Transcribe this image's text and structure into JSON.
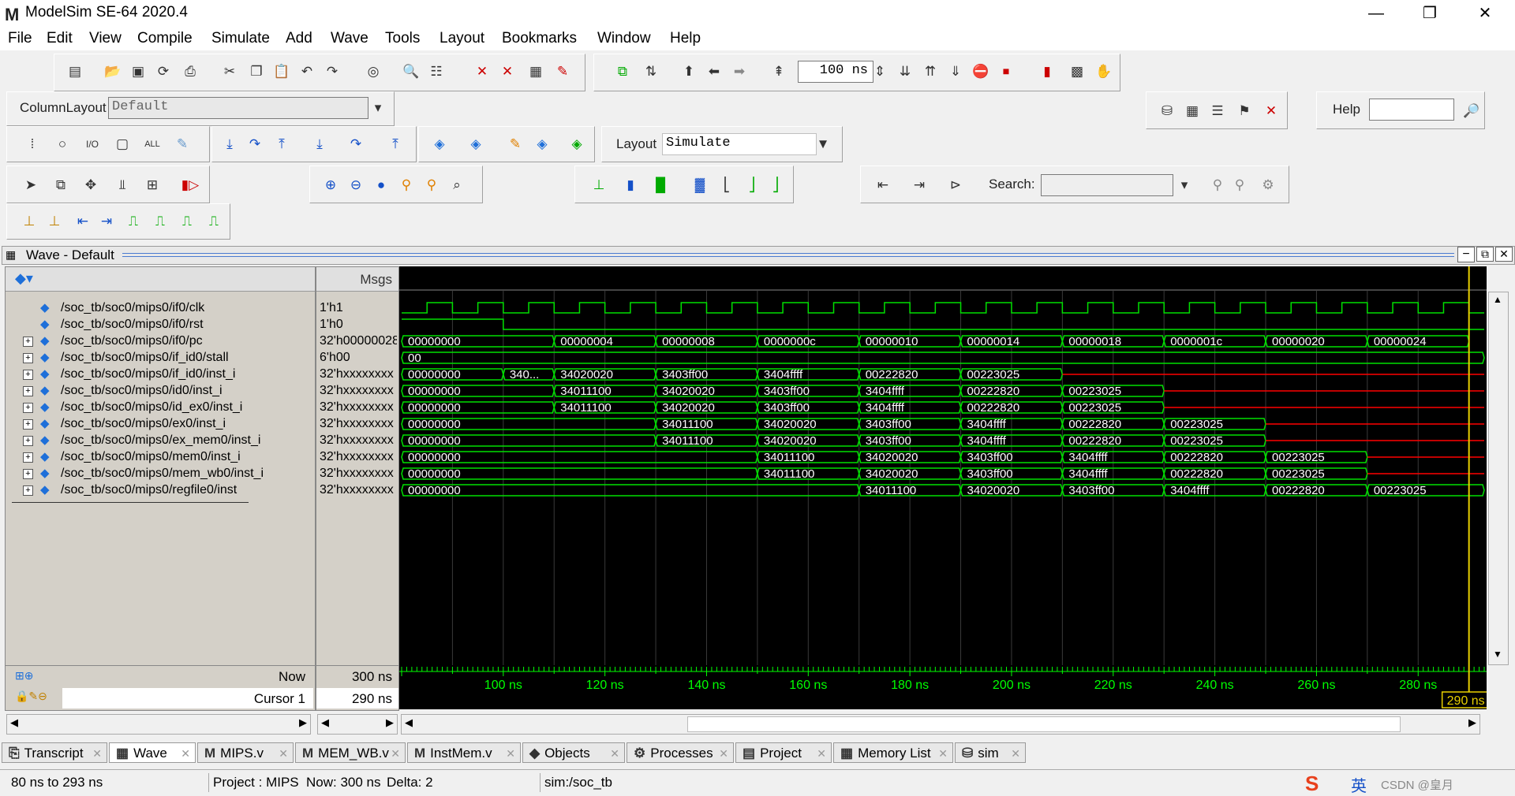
{
  "app": {
    "title": "ModelSim SE-64 2020.4",
    "logo_letter": "M",
    "window_controls": [
      "—",
      "❐",
      "✕"
    ]
  },
  "menu": [
    "File",
    "Edit",
    "View",
    "Compile",
    "Simulate",
    "Add",
    "Wave",
    "Tools",
    "Layout",
    "Bookmarks",
    "Window",
    "Help"
  ],
  "toolbar": {
    "run_length": "100 ns",
    "column_layout_label": "ColumnLayout",
    "column_layout_value": "Default",
    "layout_label": "Layout",
    "layout_value": "Simulate",
    "help_label": "Help",
    "search_label": "Search:"
  },
  "wave": {
    "window_title": "Wave - Default",
    "msgs_header": "Msgs",
    "signals": [
      {
        "name": "/soc_tb/soc0/mips0/if0/clk",
        "value": "1'h1",
        "expandable": false
      },
      {
        "name": "/soc_tb/soc0/mips0/if0/rst",
        "value": "1'h0",
        "expandable": false
      },
      {
        "name": "/soc_tb/soc0/mips0/if0/pc",
        "value": "32'h00000028",
        "expandable": true
      },
      {
        "name": "/soc_tb/soc0/mips0/if_id0/stall",
        "value": "6'h00",
        "expandable": true
      },
      {
        "name": "/soc_tb/soc0/mips0/if_id0/inst_i",
        "value": "32'hxxxxxxxx",
        "expandable": true
      },
      {
        "name": "/soc_tb/soc0/mips0/id0/inst_i",
        "value": "32'hxxxxxxxx",
        "expandable": true
      },
      {
        "name": "/soc_tb/soc0/mips0/id_ex0/inst_i",
        "value": "32'hxxxxxxxx",
        "expandable": true
      },
      {
        "name": "/soc_tb/soc0/mips0/ex0/inst_i",
        "value": "32'hxxxxxxxx",
        "expandable": true
      },
      {
        "name": "/soc_tb/soc0/mips0/ex_mem0/inst_i",
        "value": "32'hxxxxxxxx",
        "expandable": true
      },
      {
        "name": "/soc_tb/soc0/mips0/mem0/inst_i",
        "value": "32'hxxxxxxxx",
        "expandable": true
      },
      {
        "name": "/soc_tb/soc0/mips0/mem_wb0/inst_i",
        "value": "32'hxxxxxxxx",
        "expandable": true
      },
      {
        "name": "/soc_tb/soc0/mips0/regfile0/inst",
        "value": "32'hxxxxxxxx",
        "expandable": true
      }
    ],
    "bus_segments": [
      [
        [
          "00000000",
          80,
          110
        ],
        [
          "00000004",
          110,
          130
        ],
        [
          "00000008",
          130,
          150
        ],
        [
          "0000000c",
          150,
          170
        ],
        [
          "00000010",
          170,
          190
        ],
        [
          "00000014",
          190,
          210
        ],
        [
          "00000018",
          210,
          230
        ],
        [
          "0000001c",
          230,
          250
        ],
        [
          "00000020",
          250,
          270
        ],
        [
          "00000024",
          270,
          290
        ]
      ],
      [
        [
          "00",
          80,
          293
        ]
      ],
      [
        [
          "00000000",
          80,
          100
        ],
        [
          "340...",
          100,
          110
        ],
        [
          "34020020",
          110,
          130
        ],
        [
          "3403ff00",
          130,
          150
        ],
        [
          "3404ffff",
          150,
          170
        ],
        [
          "00222820",
          170,
          190
        ],
        [
          "00223025",
          190,
          210
        ],
        [
          "X",
          210,
          293
        ]
      ],
      [
        [
          "00000000",
          80,
          110
        ],
        [
          "34011100",
          110,
          130
        ],
        [
          "34020020",
          130,
          150
        ],
        [
          "3403ff00",
          150,
          170
        ],
        [
          "3404ffff",
          170,
          190
        ],
        [
          "00222820",
          190,
          210
        ],
        [
          "00223025",
          210,
          230
        ],
        [
          "X",
          230,
          293
        ]
      ],
      [
        [
          "00000000",
          80,
          110
        ],
        [
          "34011100",
          110,
          130
        ],
        [
          "34020020",
          130,
          150
        ],
        [
          "3403ff00",
          150,
          170
        ],
        [
          "3404ffff",
          170,
          190
        ],
        [
          "00222820",
          190,
          210
        ],
        [
          "00223025",
          210,
          230
        ],
        [
          "X",
          230,
          293
        ]
      ],
      [
        [
          "00000000",
          80,
          130
        ],
        [
          "34011100",
          130,
          150
        ],
        [
          "34020020",
          150,
          170
        ],
        [
          "3403ff00",
          170,
          190
        ],
        [
          "3404ffff",
          190,
          210
        ],
        [
          "00222820",
          210,
          230
        ],
        [
          "00223025",
          230,
          250
        ],
        [
          "X",
          250,
          293
        ]
      ],
      [
        [
          "00000000",
          80,
          130
        ],
        [
          "34011100",
          130,
          150
        ],
        [
          "34020020",
          150,
          170
        ],
        [
          "3403ff00",
          170,
          190
        ],
        [
          "3404ffff",
          190,
          210
        ],
        [
          "00222820",
          210,
          230
        ],
        [
          "00223025",
          230,
          250
        ],
        [
          "X",
          250,
          293
        ]
      ],
      [
        [
          "00000000",
          80,
          150
        ],
        [
          "34011100",
          150,
          170
        ],
        [
          "34020020",
          170,
          190
        ],
        [
          "3403ff00",
          190,
          210
        ],
        [
          "3404ffff",
          210,
          230
        ],
        [
          "00222820",
          230,
          250
        ],
        [
          "00223025",
          250,
          270
        ],
        [
          "X",
          270,
          293
        ]
      ],
      [
        [
          "00000000",
          80,
          150
        ],
        [
          "34011100",
          150,
          170
        ],
        [
          "34020020",
          170,
          190
        ],
        [
          "3403ff00",
          190,
          210
        ],
        [
          "3404ffff",
          210,
          230
        ],
        [
          "00222820",
          230,
          250
        ],
        [
          "00223025",
          250,
          270
        ],
        [
          "X",
          270,
          293
        ]
      ],
      [
        [
          "00000000",
          80,
          170
        ],
        [
          "34011100",
          170,
          190
        ],
        [
          "34020020",
          190,
          210
        ],
        [
          "3403ff00",
          210,
          230
        ],
        [
          "3404ffff",
          230,
          250
        ],
        [
          "00222820",
          250,
          270
        ],
        [
          "00223025",
          270,
          293
        ]
      ]
    ],
    "time_range": [
      80,
      293
    ],
    "time_ticks": [
      "100 ns",
      "120 ns",
      "140 ns",
      "160 ns",
      "180 ns",
      "200 ns",
      "220 ns",
      "240 ns",
      "260 ns",
      "280 ns"
    ],
    "now_label": "Now",
    "now_value": "300 ns",
    "cursor_label": "Cursor 1",
    "cursor_value": "290 ns",
    "cursor_time": 290,
    "cursor_tag": "290 ns"
  },
  "tabs": [
    {
      "label": "Transcript",
      "icon": "transcript-icon",
      "selected": false
    },
    {
      "label": "Wave",
      "icon": "wave-icon",
      "selected": true
    },
    {
      "label": "MIPS.v",
      "icon": "modelsim-icon",
      "selected": false
    },
    {
      "label": "MEM_WB.v",
      "icon": "modelsim-icon",
      "selected": false
    },
    {
      "label": "InstMem.v",
      "icon": "modelsim-icon",
      "selected": false
    },
    {
      "label": "Objects",
      "icon": "objects-icon",
      "selected": false
    },
    {
      "label": "Processes",
      "icon": "processes-icon",
      "selected": false
    },
    {
      "label": "Project",
      "icon": "project-icon",
      "selected": false
    },
    {
      "label": "Memory List",
      "icon": "memory-icon",
      "selected": false
    },
    {
      "label": "sim",
      "icon": "sim-icon",
      "selected": false
    }
  ],
  "status": {
    "range": "80 ns to 293 ns",
    "project": "Project : MIPS",
    "now": "Now: 300 ns",
    "delta": "Delta: 2",
    "context": "sim:/soc_tb",
    "ime_text": "英",
    "watermark": "CSDN @皇月"
  },
  "colors": {
    "wave_green": "#00e000",
    "x_red": "#ff0000",
    "cursor_yellow": "#e8d000",
    "time_green": "#00ff00"
  }
}
